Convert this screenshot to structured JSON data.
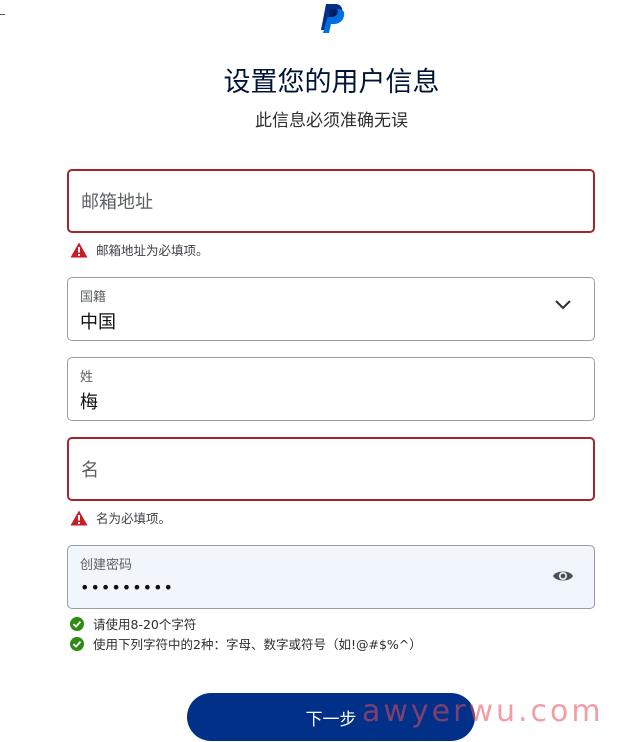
{
  "header": {
    "logo_icon": "paypal-logo-icon",
    "title": "设置您的用户信息",
    "subtitle": "此信息必须准确无误"
  },
  "form": {
    "email": {
      "placeholder": "邮箱地址",
      "value": "",
      "error": "邮箱地址为必填项。"
    },
    "nationality": {
      "label": "国籍",
      "value": "中国",
      "icon": "chevron-down-icon"
    },
    "last_name": {
      "label": "姓",
      "value": "梅"
    },
    "first_name": {
      "placeholder": "名",
      "value": "",
      "error": "名为必填项。"
    },
    "password": {
      "label": "创建密码",
      "value": "•••••••••",
      "icon": "eye-icon"
    },
    "password_rules": [
      {
        "text": "请使用8-20个字符",
        "status": "met"
      },
      {
        "text": "使用下列字符中的2种：字母、数字或符号（如!@#$%^）",
        "status": "met"
      }
    ]
  },
  "actions": {
    "next_label": "下一步"
  },
  "watermark": "awyerwu.com",
  "colors": {
    "primary_button": "#003087",
    "error": "#a4262c",
    "success": "#2e8b13",
    "title": "#001435"
  }
}
